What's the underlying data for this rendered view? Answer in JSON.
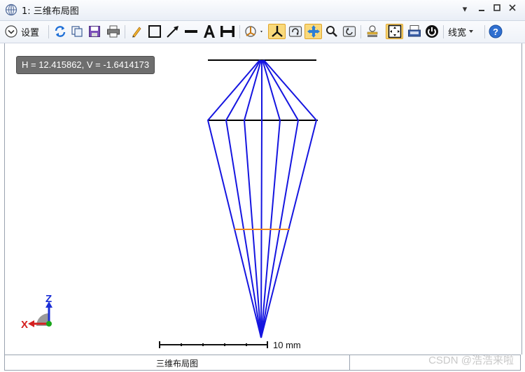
{
  "window": {
    "title": "1: 三维布局图",
    "icons": {
      "app": "layout-window-icon",
      "menu": "dropdown-arrow-icon",
      "minimize": "minimize-icon",
      "maximize": "maximize-icon",
      "close": "close-icon"
    }
  },
  "toolbar": {
    "settings_label": "设置",
    "linewidth_label": "线宽",
    "icons": [
      "settings-chevron-icon",
      "refresh-icon",
      "copy-icon",
      "save-icon",
      "print-icon",
      "pencil-icon",
      "rectangle-icon",
      "arrow-line-icon",
      "line-icon",
      "text-icon",
      "dimension-icon",
      "rotate-view-icon",
      "axes-icon",
      "rotate-icon",
      "pan-icon",
      "zoom-icon",
      "reset-view-icon",
      "layer-icon",
      "fit-window-icon",
      "window-icon",
      "power-icon",
      "linewidth-dropdown-icon",
      "help-icon"
    ]
  },
  "canvas": {
    "coordinate_readout": "H = 12.415862, V = -1.6414173",
    "scale_bar_label": "10 mm",
    "axis_labels": {
      "z": "Z",
      "x": "X"
    },
    "colors": {
      "rays": "#1515e0",
      "surfaces": "#000000",
      "image_surface": "#f08a1c",
      "axis_z": "#1b2fd6",
      "axis_x": "#d42020",
      "axis_y": "#1aa51a"
    }
  },
  "bottom_tab": {
    "label": "三维布局图"
  },
  "watermark": "CSDN @浩浩来啦"
}
